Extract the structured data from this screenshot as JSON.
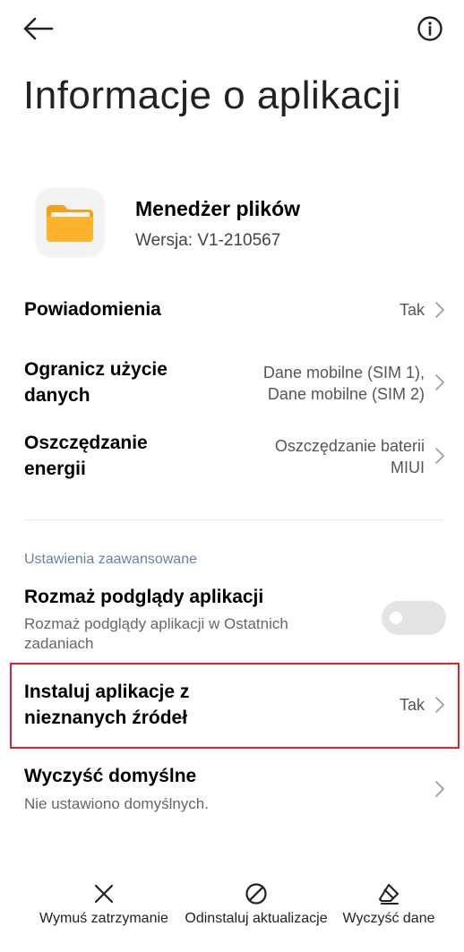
{
  "header": {
    "title": "Informacje o aplikacji",
    "back_icon": "arrow-left-icon",
    "info_icon": "info-icon"
  },
  "app": {
    "name": "Menedżer plików",
    "version": "Wersja:  V1-210567",
    "icon": "folder-icon",
    "icon_color": "#FFB22C"
  },
  "rows": {
    "notifications": {
      "title": "Powiadomienia",
      "value": "Tak"
    },
    "data_usage": {
      "title_line1": "Ogranicz użycie",
      "title_line2": "danych",
      "value_line1": "Dane mobilne (SIM 1),",
      "value_line2": "Dane mobilne (SIM 2)"
    },
    "battery": {
      "title_line1": "Oszczędzanie",
      "title_line2": "energii",
      "value_line1": "Oszczędzanie baterii",
      "value_line2": "MIUI"
    }
  },
  "advanced": {
    "label": "Ustawienia zaawansowane",
    "blur": {
      "title": "Rozmaż podglądy aplikacji",
      "subtitle_line1": "Rozmaż podglądy aplikacji w Ostatnich",
      "subtitle_line2": "zadaniach",
      "enabled": false
    },
    "unknown_sources": {
      "title_line1": "Instaluj aplikacje z",
      "title_line2": "nieznanych źródeł",
      "value": "Tak"
    },
    "clear_defaults": {
      "title": "Wyczyść domyślne",
      "subtitle": "Nie ustawiono domyślnych."
    }
  },
  "bottom_bar": {
    "force_stop": {
      "label": "Wymuś zatrzymanie",
      "icon": "close-icon"
    },
    "uninstall_updates": {
      "label": "Odinstaluj aktualizacje",
      "icon": "block-icon"
    },
    "clear_data": {
      "label": "Wyczyść dane",
      "icon": "eraser-icon"
    }
  },
  "colors": {
    "highlight": "#E0222E",
    "section_label": "#6B7FA0"
  }
}
